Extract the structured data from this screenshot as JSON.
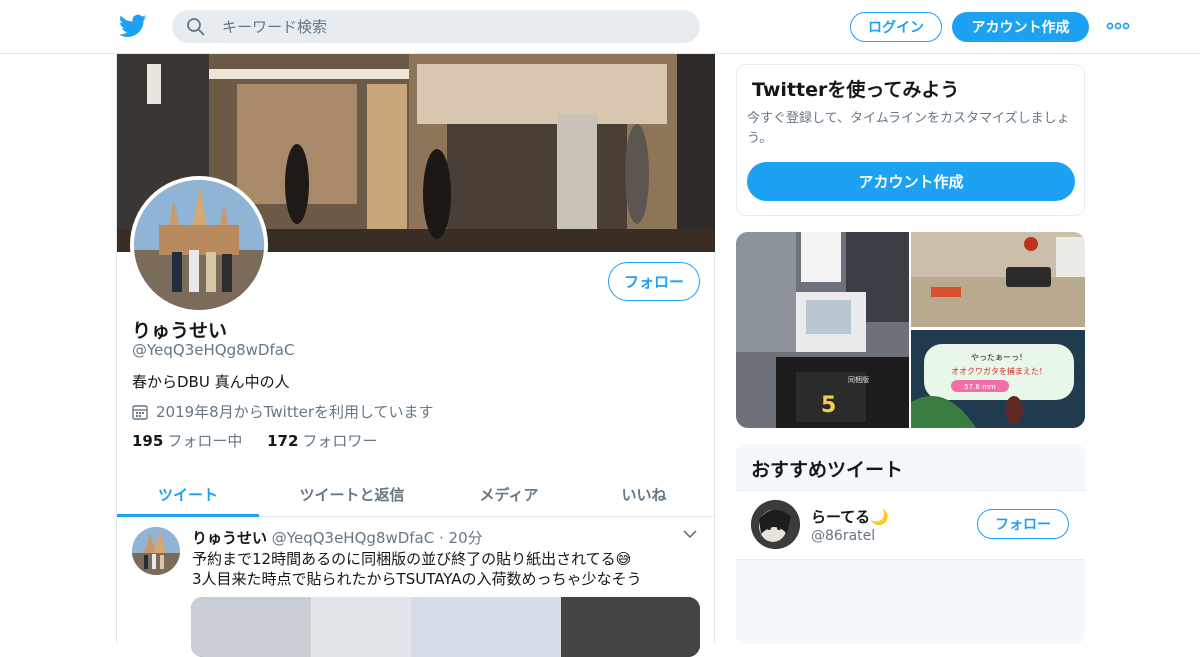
{
  "header": {
    "search_placeholder": "キーワード検索",
    "login_label": "ログイン",
    "signup_label": "アカウント作成",
    "icons": {
      "logo": "twitter-bird-icon",
      "search": "search-icon",
      "more": "more-dots-icon"
    },
    "accent_color": "#1da1f2"
  },
  "profile": {
    "name": "りゅうせい",
    "handle": "@YeqQ3eHQg8wDfaC",
    "bio": "春からDBU 真ん中の人",
    "joined": "2019年8月からTwitterを利用しています",
    "following_count": "195",
    "following_label": "フォロー中",
    "followers_count": "172",
    "followers_label": "フォロワー",
    "follow_label": "フォロー"
  },
  "tabs": [
    {
      "label": "ツイート",
      "active": true
    },
    {
      "label": "ツイートと返信",
      "active": false
    },
    {
      "label": "メディア",
      "active": false
    },
    {
      "label": "いいね",
      "active": false
    }
  ],
  "tweet": {
    "author_name": "りゅうせい",
    "author_handle": "@YeqQ3eHQg8wDfaC",
    "time": "· 20分",
    "line1": "予約まで12時間あるのに同梱版の並び終了の貼り紙出されてる😅",
    "line2": "3人目来た時点で貼られたからTSUTAYAの入荷数めっちゃ少なそう"
  },
  "signup_card": {
    "title": "Twitterを使ってみよう",
    "description": "今すぐ登録して、タイムラインをカスタマイズしましょう。",
    "button_label": "アカウント作成"
  },
  "photo_overlay": {
    "game_text": "やったぁーっ！",
    "game_text2": "オオクワガタを捕まえた！",
    "game_size": "57.8 mm",
    "sign_text": "5",
    "sign_small": "同梱版"
  },
  "recommended": {
    "title": "おすすめツイート",
    "user_name": "らーてる🌙",
    "user_handle": "@86ratel",
    "follow_label": "フォロー"
  }
}
